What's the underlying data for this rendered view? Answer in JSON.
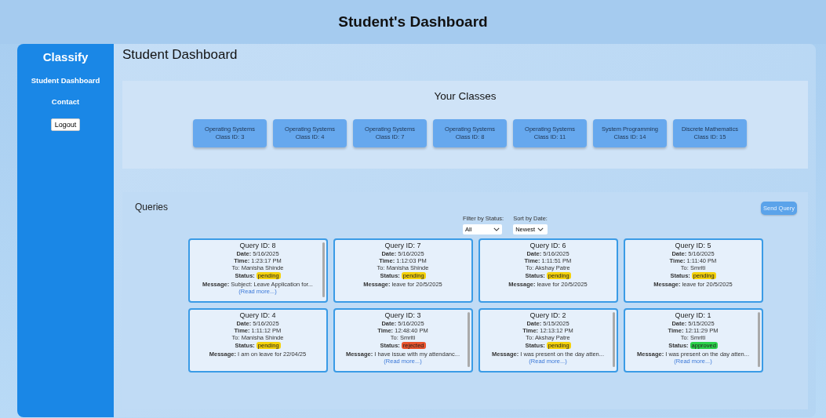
{
  "header": {
    "title": "Student's Dashboard"
  },
  "sidebar": {
    "brand": "Classify",
    "items": [
      {
        "label": "Student Dashboard"
      },
      {
        "label": "Contact"
      }
    ],
    "logout": "Logout"
  },
  "main": {
    "title": "Student Dashboard"
  },
  "classes": {
    "title": "Your Classes",
    "items": [
      {
        "subject": "Operating Systems",
        "class_id": "Class ID: 3"
      },
      {
        "subject": "Operating Systems",
        "class_id": "Class ID: 4"
      },
      {
        "subject": "Operating Systems",
        "class_id": "Class ID: 7"
      },
      {
        "subject": "Operating Systems",
        "class_id": "Class ID: 8"
      },
      {
        "subject": "Operating Systems",
        "class_id": "Class ID: 11"
      },
      {
        "subject": "System Programming",
        "class_id": "Class ID: 14"
      },
      {
        "subject": "Discrete Mathematics",
        "class_id": "Class ID: 15"
      }
    ]
  },
  "queries": {
    "title": "Queries",
    "send_button": "Send Query",
    "filter": {
      "label": "Filter by Status:",
      "value": "All"
    },
    "sort": {
      "label": "Sort by Date:",
      "value": "Newest"
    },
    "items": [
      {
        "id": "Query ID: 8",
        "date": "**Date:** 5/16/2025",
        "time": "**Time:** 1:23:17 PM",
        "to": "To: Manisha Shinde",
        "status_label": "Status:",
        "status": "pending",
        "color": "#f4d10b",
        "message": "**Message:** Subject: Leave Application for...",
        "read_more": "(Read more...)",
        "scrollbar": true
      },
      {
        "id": "Query ID: 7",
        "date": "**Date:** 5/16/2025",
        "time": "**Time:** 1:12:03 PM",
        "to": "To: Manisha Shinde",
        "status_label": "Status:",
        "status": "pending",
        "color": "#f4d10b",
        "message": "**Message:** leave for 20/5/2025",
        "scrollbar": false
      },
      {
        "id": "Query ID: 6",
        "date": "**Date:** 5/16/2025",
        "time": "**Time:** 1:11:51 PM",
        "to": "To: Akshay Patre",
        "status_label": "Status:",
        "status": "pending",
        "color": "#f4d10b",
        "message": "**Message:** leave for 20/5/2025",
        "scrollbar": false
      },
      {
        "id": "Query ID: 5",
        "date": "**Date:** 5/16/2025",
        "time": "**Time:** 1:11:40 PM",
        "to": "To: Smriti",
        "status_label": "Status:",
        "status": "pending",
        "color": "#f4d10b",
        "message": "**Message:** leave for 20/5/2025",
        "scrollbar": false
      },
      {
        "id": "Query ID: 4",
        "date": "**Date:** 5/16/2025",
        "time": "**Time:** 1:11:12 PM",
        "to": "To: Manisha Shinde",
        "status_label": "Status:",
        "status": "pending",
        "color": "#f4d10b",
        "message": "**Message:** I am on leave for 22/04/25",
        "scrollbar": false
      },
      {
        "id": "Query ID: 3",
        "date": "**Date:** 5/16/2025",
        "time": "**Time:** 12:48:40 PM",
        "to": "To: Smriti",
        "status_label": "Status:",
        "status": "rejected",
        "color": "#e8532d",
        "message": "**Message:** I have issue with my attendanc...",
        "read_more": "(Read more...)",
        "scrollbar": true
      },
      {
        "id": "Query ID: 2",
        "date": "**Date:** 5/15/2025",
        "time": "**Time:** 12:13:12 PM",
        "to": "To: Akshay Patre",
        "status_label": "Status:",
        "status": "pending",
        "color": "#f4d10b",
        "message": "**Message:** I was present on the day atten...",
        "read_more": "(Read more...)",
        "scrollbar": true
      },
      {
        "id": "Query ID: 1",
        "date": "**Date:** 5/15/2025",
        "time": "**Time:** 12:11:29 PM",
        "to": "To: Smriti",
        "status_label": "Status:",
        "status": "approved",
        "color": "#2bd14a",
        "message": "**Message:** I was present on the day atten...",
        "read_more": "(Read more...)",
        "scrollbar": true
      }
    ]
  }
}
